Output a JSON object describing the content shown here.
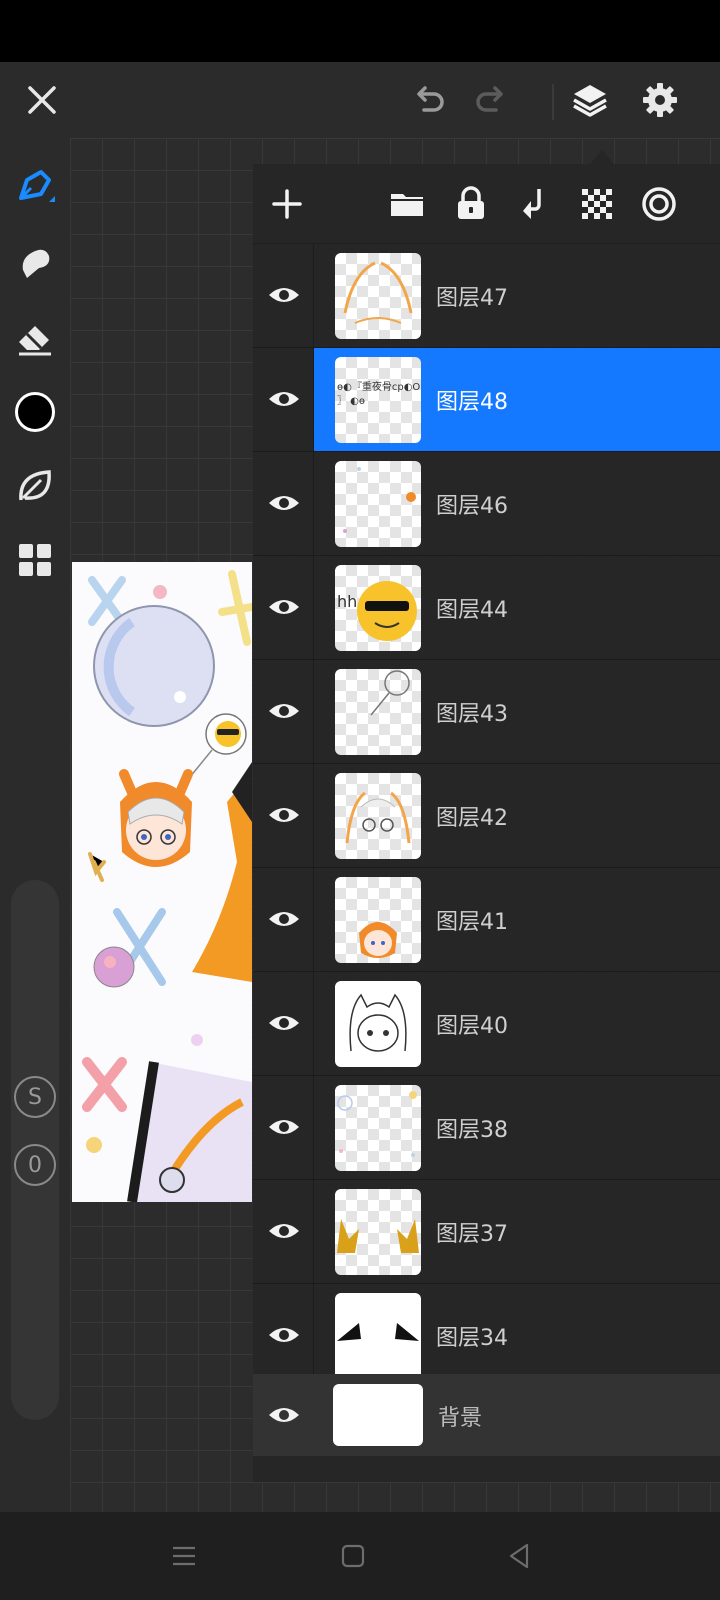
{
  "toolbar": {
    "close_icon": "close-icon",
    "undo_icon": "undo-icon",
    "redo_icon": "redo-icon",
    "layers_icon": "layers-icon",
    "settings_icon": "gear-icon"
  },
  "left_tools": [
    {
      "name": "brush-tool",
      "icon": "pen-icon",
      "active": true
    },
    {
      "name": "smudge-tool",
      "icon": "smudge-icon"
    },
    {
      "name": "eraser-tool",
      "icon": "eraser-icon"
    },
    {
      "name": "color-picker",
      "icon": "color-swatch",
      "color": "#000000"
    },
    {
      "name": "brush-library",
      "icon": "leaf-icon"
    },
    {
      "name": "materials",
      "icon": "grid-icon"
    }
  ],
  "slider": {
    "size_badge": "S",
    "opacity_badge": "0"
  },
  "layers_panel": {
    "actions": [
      "add-layer",
      "folder",
      "lock",
      "merge-down",
      "transparency",
      "mask"
    ],
    "layers": [
      {
        "name": "图层47",
        "visible": true,
        "selected": false
      },
      {
        "name": "图层48",
        "visible": true,
        "selected": true,
        "thumb_text": "ɵ◐『重夜骨cp◐OK\n〗 ◐ɵ"
      },
      {
        "name": "图层46",
        "visible": true,
        "selected": false
      },
      {
        "name": "图层44",
        "visible": true,
        "selected": false,
        "thumb_text": "hh"
      },
      {
        "name": "图层43",
        "visible": true,
        "selected": false
      },
      {
        "name": "图层42",
        "visible": true,
        "selected": false
      },
      {
        "name": "图层41",
        "visible": true,
        "selected": false
      },
      {
        "name": "图层40",
        "visible": true,
        "selected": false
      },
      {
        "name": "图层38",
        "visible": true,
        "selected": false
      },
      {
        "name": "图层37",
        "visible": true,
        "selected": false
      },
      {
        "name": "图层34",
        "visible": true,
        "selected": false
      }
    ],
    "background": {
      "name": "背景",
      "visible": true
    }
  },
  "colors": {
    "accent": "#1479ff",
    "panel": "#262626",
    "toolbar": "#2b2b2b"
  }
}
